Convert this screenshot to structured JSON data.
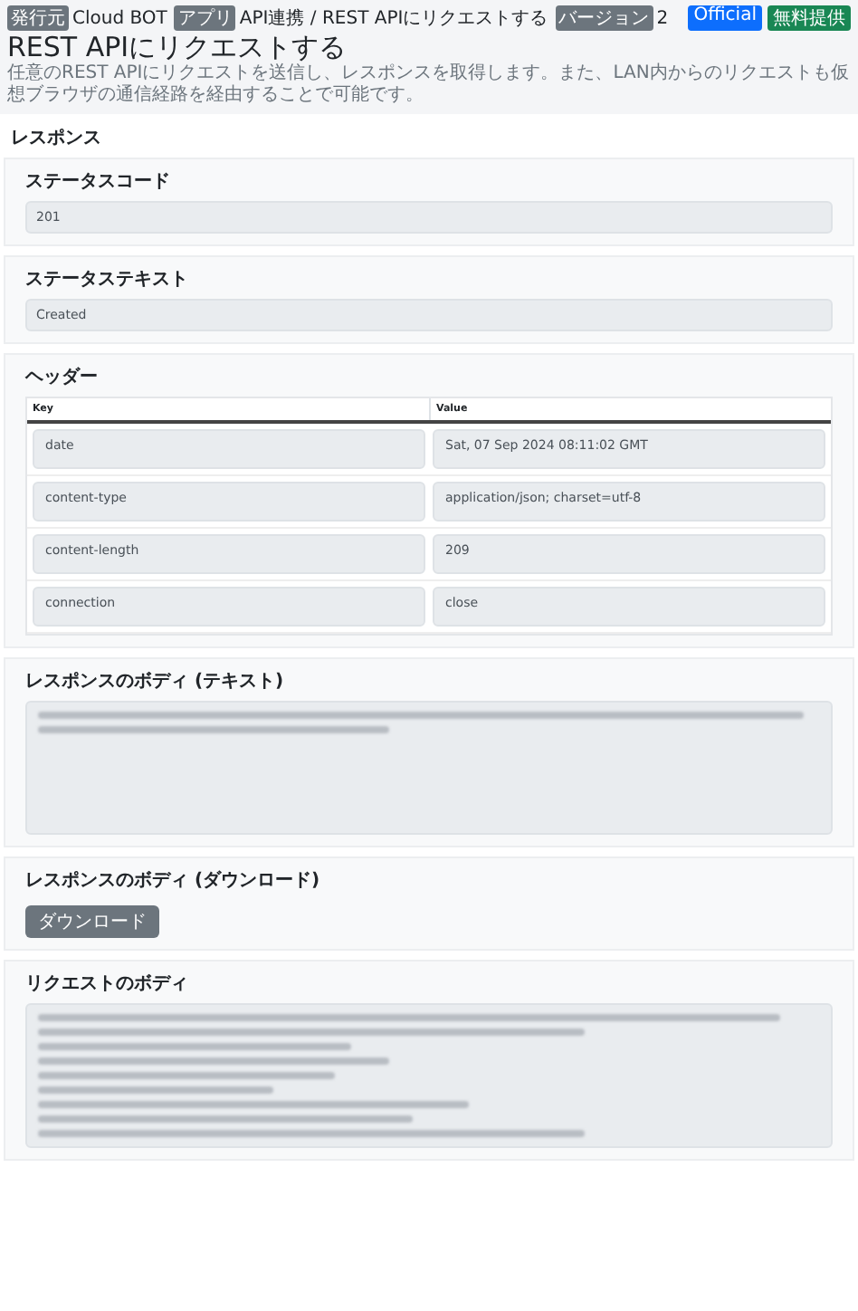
{
  "breadcrumb": [
    {
      "badge": "発行元",
      "text": "Cloud BOT"
    },
    {
      "badge": "アプリ",
      "text": "API連携 / REST APIにリクエストする"
    },
    {
      "badge": "バージョン",
      "text": "2"
    }
  ],
  "tags": [
    {
      "label": "Official",
      "color": "#0d6efd"
    },
    {
      "label": "無料提供",
      "color": "#198754"
    }
  ],
  "title": "REST APIにリクエストする",
  "description": "任意のREST APIにリクエストを送信し、レスポンスを取得します。また、LAN内からのリクエストも仮想ブラウザの通信経路を経由することで可能です。",
  "section_title": "レスポンス",
  "cards": [
    {
      "kind": "field",
      "title": "ステータスコード",
      "value": "201"
    },
    {
      "kind": "field",
      "title": "ステータステキスト",
      "value": "Created"
    },
    {
      "kind": "table",
      "title": "ヘッダー",
      "columns": [
        "Key",
        "Value"
      ],
      "rows": [
        [
          "date",
          "Sat, 07 Sep 2024 08:11:02 GMT"
        ],
        [
          "content-type",
          "application/json; charset=utf-8"
        ],
        [
          "content-length",
          "209"
        ],
        [
          "connection",
          "close"
        ]
      ]
    },
    {
      "kind": "text_body",
      "title": "レスポンスのボディ (テキスト)"
    },
    {
      "kind": "button",
      "title": "レスポンスのボディ (ダウンロード)",
      "button": "ダウンロード"
    },
    {
      "kind": "json_body",
      "title": "リクエストのボディ"
    }
  ]
}
